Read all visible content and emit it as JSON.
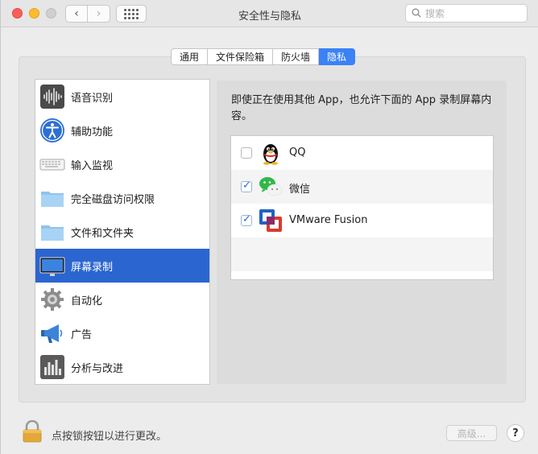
{
  "window": {
    "title": "安全性与隐私",
    "search_placeholder": "搜索"
  },
  "tabs": [
    {
      "label": "通用",
      "active": false
    },
    {
      "label": "文件保险箱",
      "active": false
    },
    {
      "label": "防火墙",
      "active": false
    },
    {
      "label": "隐私",
      "active": true
    }
  ],
  "sidebar": {
    "items": [
      {
        "label": "语音识别",
        "icon": "waveform-icon"
      },
      {
        "label": "辅助功能",
        "icon": "accessibility-icon"
      },
      {
        "label": "输入监视",
        "icon": "keyboard-icon"
      },
      {
        "label": "完全磁盘访问权限",
        "icon": "folder-icon"
      },
      {
        "label": "文件和文件夹",
        "icon": "folder-icon"
      },
      {
        "label": "屏幕录制",
        "icon": "display-icon",
        "selected": true
      },
      {
        "label": "自动化",
        "icon": "gear-icon"
      },
      {
        "label": "广告",
        "icon": "megaphone-icon"
      },
      {
        "label": "分析与改进",
        "icon": "bar-chart-icon"
      }
    ]
  },
  "panel": {
    "description": "即使正在使用其他 App，也允许下面的 App 录制屏幕内容。",
    "apps": [
      {
        "name": "QQ",
        "checked": false,
        "icon": "qq-penguin-icon"
      },
      {
        "name": "微信",
        "checked": true,
        "icon": "wechat-icon"
      },
      {
        "name": "VMware Fusion",
        "checked": true,
        "icon": "vmware-icon"
      }
    ]
  },
  "footer": {
    "lock_text": "点按锁按钮以进行更改。",
    "advanced_label": "高级...",
    "help_label": "?"
  },
  "colors": {
    "accent": "#3a82f6",
    "selection": "#2b65d0"
  }
}
